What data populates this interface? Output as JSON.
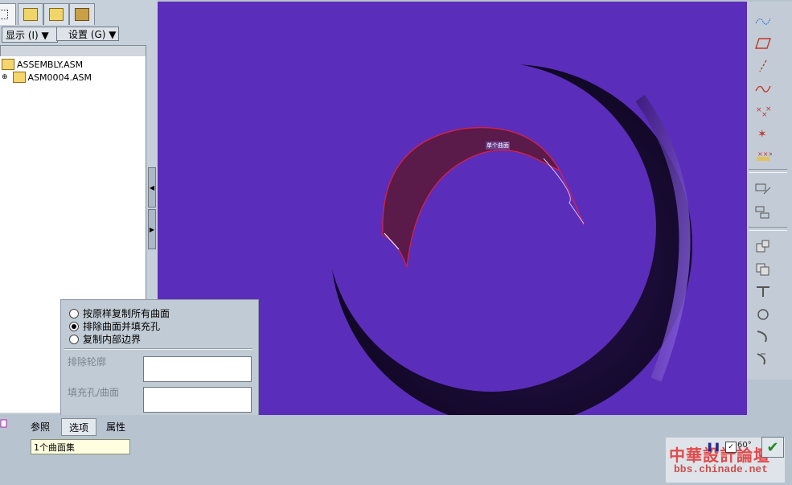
{
  "left_panel": {
    "tabs": [
      {
        "icon": "model-tree-icon"
      },
      {
        "icon": "folder-browser-icon"
      },
      {
        "icon": "favorites-icon"
      },
      {
        "icon": "tools-icon"
      }
    ],
    "toolbar": {
      "show_label": "显示 (I) ▼",
      "settings_label": "设置 (G) ▼"
    },
    "tree": [
      {
        "label": "ASSEMBLY.ASM",
        "icon": "assembly-icon"
      },
      {
        "label": "ASM0004.ASM",
        "icon": "assembly-icon"
      }
    ]
  },
  "viewport": {
    "background_color": "#5b2dbb",
    "surface_label": "单个曲面"
  },
  "right_toolbar": {
    "icons": [
      "datum-curve-icon",
      "datum-plane-icon",
      "datum-axis-icon",
      "sketch-curve-icon",
      "datum-point-icon",
      "offset-point-icon",
      "coordinate-system-icon",
      "view-manager-icon",
      "layer-icon",
      "insert-feature-icon",
      "copy-icon",
      "trim-icon",
      "revolve-icon",
      "sweep-icon",
      "blend-icon"
    ]
  },
  "options_popup": {
    "radio_options": [
      {
        "label": "按原样复制所有曲面",
        "selected": false
      },
      {
        "label": "排除曲面并填充孔",
        "selected": true
      },
      {
        "label": "复制内部边界",
        "selected": false
      }
    ],
    "exclude_contour_label": "排除轮廓",
    "exclude_contour_value": "",
    "fill_hole_label": "填充孔/曲面",
    "fill_hole_value": ""
  },
  "dashboard": {
    "tabs": [
      {
        "label": "参照",
        "active": false
      },
      {
        "label": "选项",
        "active": true
      },
      {
        "label": "属性",
        "active": false
      }
    ],
    "surface_set_value": "1个曲面集",
    "preview_label": "60°",
    "confirm_icon": "checkmark-icon",
    "pause_icon": "pause-icon"
  },
  "watermark": {
    "title": "中華設計論壇",
    "url": "bbs.chinade.net"
  }
}
